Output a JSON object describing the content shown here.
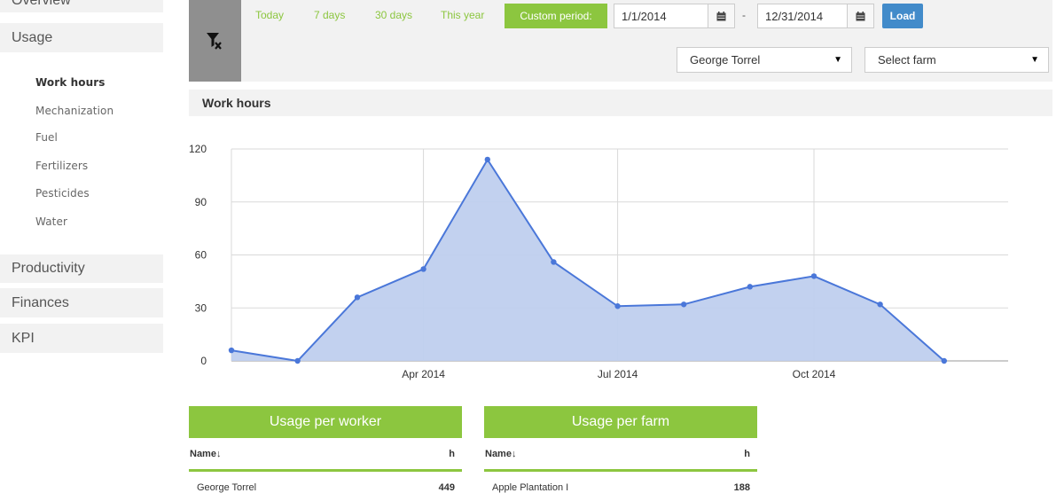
{
  "sidebar": {
    "overview": "Overview",
    "usage": "Usage",
    "usage_items": [
      "Work hours",
      "Mechanization",
      "Fuel",
      "Fertilizers",
      "Pesticides",
      "Water"
    ],
    "productivity": "Productivity",
    "finances": "Finances",
    "kpi": "KPI"
  },
  "filters": {
    "clear_icon": "filter-clear-icon",
    "periods": [
      "Today",
      "7 days",
      "30 days",
      "This year"
    ],
    "custom_period": "Custom period:",
    "date_from": "1/1/2014",
    "date_separator": "-",
    "date_to": "12/31/2014",
    "load": "Load",
    "worker_select": "George Torrel",
    "farm_select": "Select farm"
  },
  "section": {
    "title": "Work hours"
  },
  "chart_data": {
    "type": "area",
    "x": [
      "2014-01-01",
      "2014-02-01",
      "2014-03-01",
      "2014-04-01",
      "2014-05-01",
      "2014-06-01",
      "2014-07-01",
      "2014-08-01",
      "2014-09-01",
      "2014-10-01",
      "2014-11-01",
      "2014-12-01"
    ],
    "series": [
      {
        "values": [
          6,
          0,
          36,
          52,
          114,
          56,
          31,
          32,
          42,
          48,
          32,
          0
        ]
      }
    ],
    "x_ticks": [
      "Apr 2014",
      "Jul 2014",
      "Oct 2014"
    ],
    "y_ticks": [
      0,
      30,
      60,
      90,
      120
    ],
    "ylim": [
      0,
      120
    ],
    "grid": true,
    "colors": {
      "line": "#4a77d9",
      "fill": "#bfcfee",
      "grid": "#d9d9d9"
    }
  },
  "tables": {
    "worker": {
      "title": "Usage per worker",
      "col_name": "Name↓",
      "col_unit": "h",
      "rows": [
        {
          "name": "George Torrel",
          "value": "449"
        }
      ]
    },
    "farm": {
      "title": "Usage per farm",
      "col_name": "Name↓",
      "col_unit": "h",
      "rows": [
        {
          "name": "Apple Plantation I",
          "value": "188"
        }
      ]
    }
  },
  "colors": {
    "accent_green": "#8cc63f",
    "load_blue": "#428bca",
    "panel_grey": "#f2f2f2"
  }
}
